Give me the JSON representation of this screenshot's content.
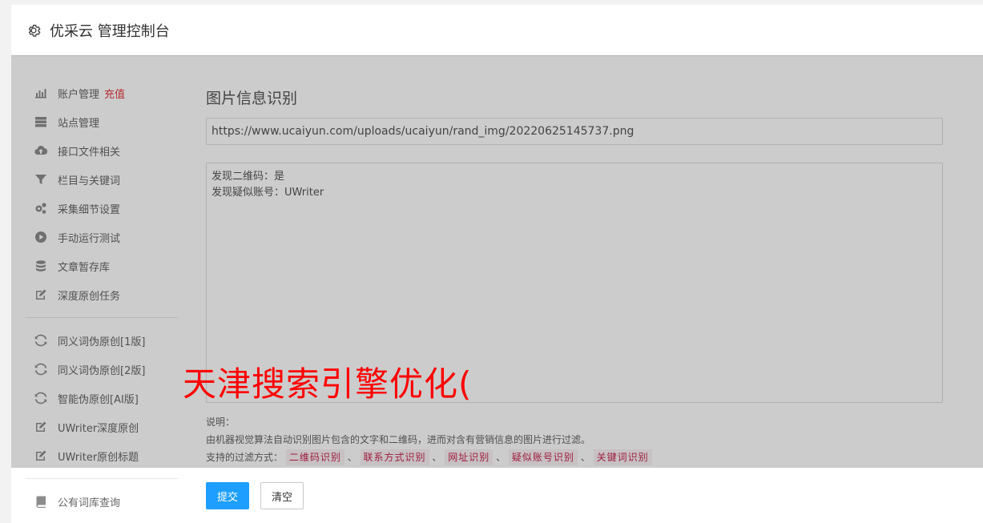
{
  "header": {
    "title": "优采云 管理控制台",
    "icon": "gear-icon"
  },
  "sidebar": {
    "items": [
      {
        "label": "账户管理",
        "badge": "充值",
        "icon": "bar-chart-icon"
      },
      {
        "label": "站点管理",
        "icon": "server-icon"
      },
      {
        "label": "接口文件相关",
        "icon": "cloud-upload-icon"
      },
      {
        "label": "栏目与关键词",
        "icon": "filter-icon"
      },
      {
        "label": "采集细节设置",
        "icon": "gears-icon"
      },
      {
        "label": "手动运行测试",
        "icon": "play-circle-icon"
      },
      {
        "label": "文章暂存库",
        "icon": "database-icon"
      },
      {
        "label": "深度原创任务",
        "icon": "edit-icon"
      },
      {
        "label": "同义词伪原创[1版]",
        "icon": "refresh-icon"
      },
      {
        "label": "同义词伪原创[2版]",
        "icon": "refresh-icon"
      },
      {
        "label": "智能伪原创[AI版]",
        "icon": "refresh-icon"
      },
      {
        "label": "UWriter深度原创",
        "icon": "edit-icon"
      },
      {
        "label": "UWriter原创标题",
        "icon": "edit-icon"
      },
      {
        "label": "公有词库查询",
        "icon": "book-icon"
      }
    ]
  },
  "main": {
    "title": "图片信息识别",
    "url_value": "https://www.ucaiyun.com/uploads/ucaiyun/rand_img/20220625145737.png",
    "result_lines": [
      "发现二维码：是",
      "发现疑似账号：UWriter"
    ],
    "notes_heading": "说明：",
    "notes_desc": "由机器视觉算法自动识别图片包含的文字和二维码，进而对含有营销信息的图片进行过滤。",
    "filters_label": "支持的过滤方式：",
    "filters": [
      "二维码识别",
      "联系方式识别",
      "网址识别",
      "疑似账号识别",
      "关键词识别"
    ],
    "separator": "、",
    "submit_label": "提交",
    "clear_label": "清空"
  },
  "watermark": "天津搜索引擎优化(",
  "colors": {
    "primary": "#1e9fff",
    "badge": "#e4393c",
    "tag_text": "#c7254e",
    "watermark": "#ff0000"
  }
}
